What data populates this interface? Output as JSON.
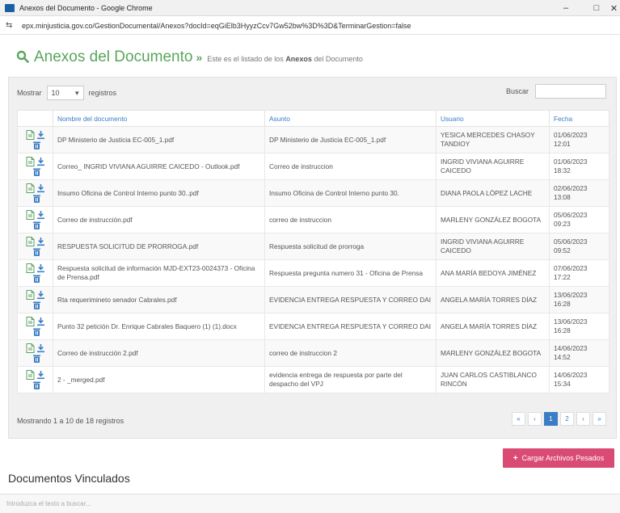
{
  "window": {
    "title": "Anexos del Documento - Google Chrome",
    "minimize": "–",
    "maximize": "□",
    "close": "✕"
  },
  "address": {
    "url": "epx.minjusticia.gov.co/GestionDocumental/Anexos?docId=eqGiElb3HyyzCcv7Gw52bw%3D%3D&TerminarGestion=false"
  },
  "header": {
    "title": "Anexos del Documento",
    "arrow": "»",
    "subtitle_pre": "Este es el listado de los ",
    "subtitle_bold": "Anexos",
    "subtitle_post": " del Documento"
  },
  "controls": {
    "show_label": "Mostrar",
    "page_size": "10",
    "records_label": "registros",
    "search_label": "Buscar"
  },
  "table": {
    "headers": [
      "Nombre del documento",
      "Asunto",
      "Usuario",
      "Fecha"
    ],
    "rows": [
      {
        "name": "DP Ministerio de Justicia EC-005_1.pdf",
        "subject": "DP Ministerio de Justicia EC-005_1.pdf",
        "user": "YESICA MERCEDES CHASOY TANDIOY",
        "date": "01/06/2023 12:01",
        "type": "pdf"
      },
      {
        "name": "Correo_ INGRID VIVIANA AGUIRRE CAICEDO - Outlook.pdf",
        "subject": "Correo de instruccion",
        "user": "INGRID VIVIANA AGUIRRE CAICEDO",
        "date": "01/06/2023 18:32",
        "type": "pdf"
      },
      {
        "name": "Insumo Oficina de Control Interno punto 30..pdf",
        "subject": "Insumo Oficina de Control Interno punto 30.",
        "user": "DIANA PAOLA LÓPEZ LACHE",
        "date": "02/06/2023 13:08",
        "type": "pdf"
      },
      {
        "name": "Correo de instrucción.pdf",
        "subject": "correo de instruccion",
        "user": "MARLENY GONZÁLEZ BOGOTA",
        "date": "05/06/2023 09:23",
        "type": "pdf"
      },
      {
        "name": "RESPUESTA SOLICITUD DE PRORROGA.pdf",
        "subject": "Respuesta solicitud de prorroga",
        "user": "INGRID VIVIANA AGUIRRE CAICEDO",
        "date": "05/06/2023 09:52",
        "type": "pdf"
      },
      {
        "name": "Respuesta solicitud de información MJD-EXT23-0024373 - Oficina de Prensa.pdf",
        "subject": "Respuesta pregunta numero 31 - Oficina de Prensa",
        "user": "ANA MARÍA BEDOYA JIMÉNEZ",
        "date": "07/06/2023 17:22",
        "type": "pdf"
      },
      {
        "name": "Rta requerimineto senador Cabrales.pdf",
        "subject": "EVIDENCIA ENTREGA RESPUESTA Y CORREO DAI",
        "user": "ANGELA MARÍA TORRES DÍAZ",
        "date": "13/06/2023 16:28",
        "type": "pdf"
      },
      {
        "name": "Punto 32 petición Dr. Enrique Cabrales Baquero (1) (1).docx",
        "subject": "EVIDENCIA ENTREGA RESPUESTA Y CORREO DAI",
        "user": "ANGELA MARÍA TORRES DÍAZ",
        "date": "13/06/2023 16:28",
        "type": "doc"
      },
      {
        "name": "Correo de instrucción 2.pdf",
        "subject": "correo de instruccion 2",
        "user": "MARLENY GONZÁLEZ BOGOTA",
        "date": "14/06/2023 14:52",
        "type": "pdf"
      },
      {
        "name": "2 - _merged.pdf",
        "subject": "evidencia entrega de respuesta por parte del despacho del VPJ",
        "user": "JUAN CARLOS CASTIBLANCO RINCÓN",
        "date": "14/06/2023 15:34",
        "type": "pdf"
      }
    ]
  },
  "footer": {
    "info": "Mostrando 1 a 10 de 18 registros",
    "pager": [
      "«",
      "‹",
      "1",
      "2",
      "›",
      "»"
    ],
    "active_page": "1"
  },
  "upload_button": {
    "plus": "+",
    "label": "Cargar Archivos Pesados"
  },
  "linked_docs": {
    "title": "Documentos Vinculados",
    "placeholder": "Introduzca el texto a buscar..."
  },
  "icons": {
    "search": "search-icon",
    "file_pdf": "file-pdf-icon",
    "file_doc": "file-doc-icon",
    "download": "download-icon",
    "delete": "trash-icon"
  },
  "colors": {
    "accent_green": "#58a65c",
    "link_blue": "#3a7dc4",
    "button_pink": "#d94b72"
  }
}
